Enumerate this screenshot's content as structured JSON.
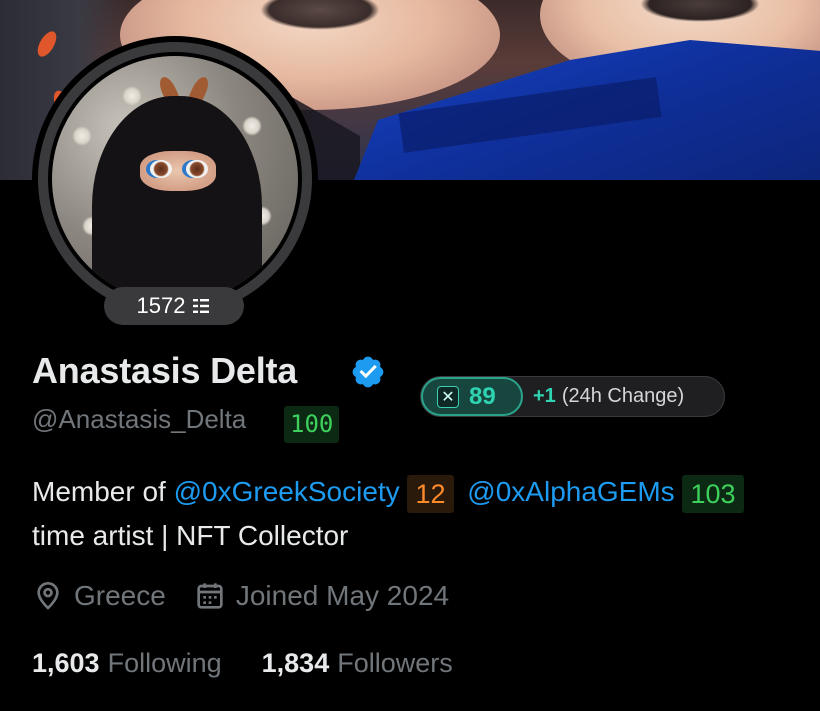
{
  "profile": {
    "name": "Anastasis Delta",
    "handle": "@Anastasis_Delta",
    "handle_score": "100",
    "avatar_score": "1572",
    "badge": {
      "score": "89",
      "delta": "+1",
      "delta_label": "(24h Change)"
    },
    "bio": {
      "prefix": "Member of",
      "mention1": "@0xGreekSociety",
      "mention1_score": "12",
      "mention2": "@0xAlphaGEMs",
      "mention2_score": "103",
      "continuation": "time artist | NFT Collector"
    },
    "location": "Greece",
    "joined": "Joined May 2024",
    "following_count": "1,603",
    "following_label": "Following",
    "followers_count": "1,834",
    "followers_label": "Followers"
  },
  "colors": {
    "accent_link": "#1d9bf0",
    "score_teal": "#2fd3b2",
    "score_green": "#3dd05d",
    "score_orange": "#ff8a2a",
    "muted": "#71767b"
  },
  "icons": {
    "verified": "verified-badge-icon",
    "location": "location-pin-icon",
    "calendar": "calendar-icon",
    "score": "score-bars-icon",
    "x": "x-logo-icon"
  }
}
